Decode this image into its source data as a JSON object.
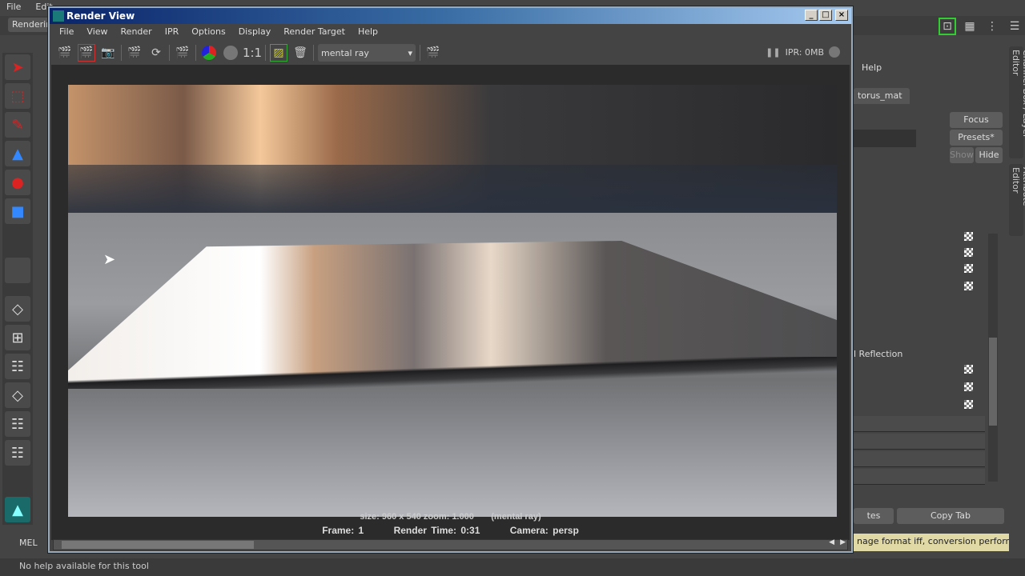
{
  "main_menu": [
    "File",
    "Edit"
  ],
  "shelf_tab": "Rendering",
  "window": {
    "title": "Render View",
    "minimize": "_",
    "maximize": "□",
    "close": "×"
  },
  "menu": [
    "File",
    "View",
    "Render",
    "IPR",
    "Options",
    "Display",
    "Render Target",
    "Help"
  ],
  "toolbar": {
    "ratio": "1:1",
    "renderer": "mental ray",
    "ipr_status": "IPR: 0MB"
  },
  "info": {
    "size_line": "size: 960 x 540 zoom: 1.000",
    "renderer_line": "(mental ray)",
    "frame": "Frame: 1",
    "render_time": "Render Time: 0:31",
    "camera": "Camera: persp"
  },
  "mel_label": "MEL",
  "help_line": "No help available for this tool",
  "attribute_editor": {
    "help": "Help",
    "tab": "torus_mat",
    "focus": "Focus",
    "presets": "Presets*",
    "show": "Show",
    "hide": "Hide",
    "section": "l Reflection",
    "left_button": "tes",
    "copy_tab": "Copy Tab"
  },
  "side_tabs": [
    "Channel Box / Layer Editor",
    "Attribute Editor"
  ],
  "feedback": "nage format iff, conversion performed b"
}
